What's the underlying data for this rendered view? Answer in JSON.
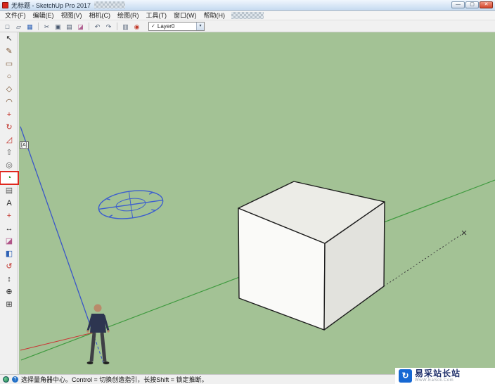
{
  "window": {
    "title": "无标题 - SketchUp Pro 2017",
    "controls": {
      "minimize": "—",
      "maximize": "▢",
      "close": "✕"
    }
  },
  "menu": {
    "items": [
      "文件(F)",
      "编辑(E)",
      "视图(V)",
      "相机(C)",
      "绘图(R)",
      "工具(T)",
      "窗口(W)",
      "帮助(H)"
    ]
  },
  "toolbar": {
    "buttons": [
      {
        "name": "new",
        "glyph": "□"
      },
      {
        "name": "open",
        "glyph": "▱"
      },
      {
        "name": "save",
        "glyph": "▦"
      },
      {
        "name": "cut",
        "glyph": "✂"
      },
      {
        "name": "copy",
        "glyph": "▣"
      },
      {
        "name": "paste",
        "glyph": "▤"
      },
      {
        "name": "erase",
        "glyph": "◪"
      },
      {
        "name": "undo",
        "glyph": "↶"
      },
      {
        "name": "redo",
        "glyph": "↷"
      },
      {
        "name": "print",
        "glyph": "▥"
      },
      {
        "name": "paint",
        "glyph": "◉"
      }
    ],
    "layer_combo": {
      "check": "✓",
      "value": "Layer0",
      "arrow": "▾"
    }
  },
  "tool_palette": {
    "tools": [
      {
        "name": "select",
        "glyph": "↖"
      },
      {
        "name": "line",
        "glyph": "✎"
      },
      {
        "name": "rectangle",
        "glyph": "▭"
      },
      {
        "name": "circle",
        "glyph": "○"
      },
      {
        "name": "polygon",
        "glyph": "◇"
      },
      {
        "name": "arc",
        "glyph": "◠"
      },
      {
        "name": "move",
        "glyph": "+"
      },
      {
        "name": "rotate",
        "glyph": "↻"
      },
      {
        "name": "scale",
        "glyph": "◿"
      },
      {
        "name": "push-pull",
        "glyph": "⇧"
      },
      {
        "name": "offset",
        "glyph": "◎"
      },
      {
        "name": "protractor",
        "glyph": "◔",
        "active": true
      },
      {
        "name": "tape-measure",
        "glyph": "▤"
      },
      {
        "name": "text",
        "glyph": "A"
      },
      {
        "name": "axes",
        "glyph": "+"
      },
      {
        "name": "dimension",
        "glyph": "↔"
      },
      {
        "name": "eraser",
        "glyph": "◪"
      },
      {
        "name": "paint-bucket",
        "glyph": "◧"
      },
      {
        "name": "orbit",
        "glyph": "↺"
      },
      {
        "name": "pan",
        "glyph": "↕"
      },
      {
        "name": "zoom",
        "glyph": "⊕"
      },
      {
        "name": "zoom-extents",
        "glyph": "⊞"
      }
    ],
    "shortcut_badge": "[A]"
  },
  "canvas": {
    "background": "#a3c295",
    "axis_colors": {
      "red": "#cc3333",
      "green": "#3f9a3f",
      "blue": "#3a56c8"
    },
    "active_tool": "protractor"
  },
  "status_bar": {
    "help_glyph": "?",
    "message": "选择量角器中心。Control = 切换创造指引，长按Shift = 锁定推断。"
  },
  "watermark": {
    "logo_glyph": "↻",
    "title": "易采站长站",
    "subtitle": "WwW.EaSck.Com",
    "brand_color": "#1668d3"
  }
}
